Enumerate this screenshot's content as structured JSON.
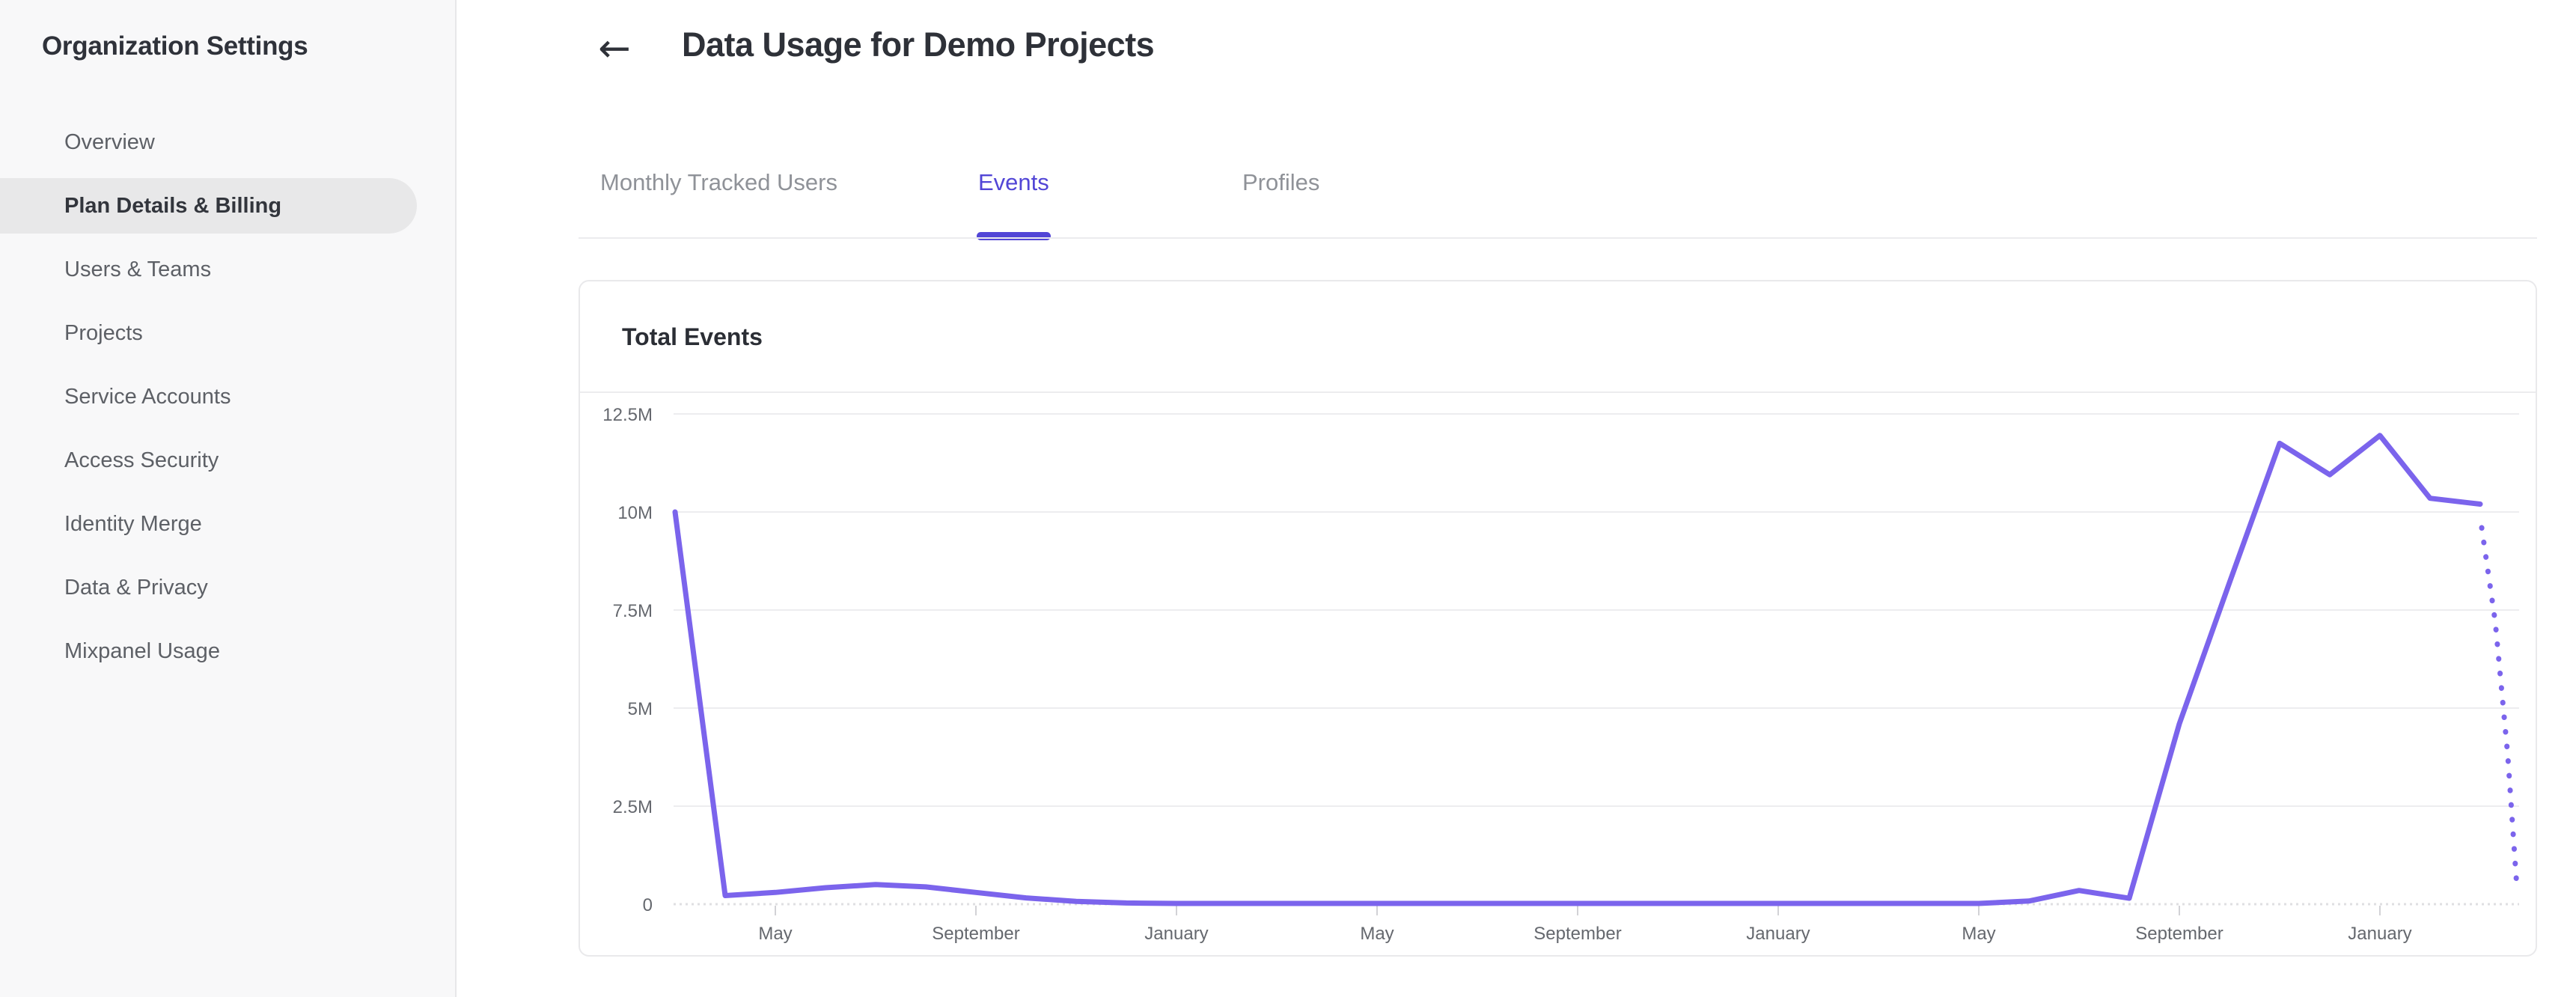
{
  "sidebar": {
    "title": "Organization Settings",
    "items": [
      {
        "label": "Overview",
        "active": false
      },
      {
        "label": "Plan Details & Billing",
        "active": true
      },
      {
        "label": "Users & Teams",
        "active": false
      },
      {
        "label": "Projects",
        "active": false
      },
      {
        "label": "Service Accounts",
        "active": false
      },
      {
        "label": "Access Security",
        "active": false
      },
      {
        "label": "Identity Merge",
        "active": false
      },
      {
        "label": "Data & Privacy",
        "active": false
      },
      {
        "label": "Mixpanel Usage",
        "active": false
      }
    ]
  },
  "header": {
    "back_icon": "←",
    "title": "Data Usage for Demo Projects"
  },
  "tabs": [
    {
      "label": "Monthly Tracked Users",
      "active": false
    },
    {
      "label": "Events",
      "active": true
    },
    {
      "label": "Profiles",
      "active": false
    }
  ],
  "colors": {
    "accent": "#5246d6",
    "line": "#7b64ec",
    "grid": "#ededef"
  },
  "chart_data": {
    "type": "line",
    "title": "Total Events",
    "ylabel": "",
    "xlabel": "",
    "ylim_millions": [
      0,
      12.5
    ],
    "grid": true,
    "legend": false,
    "y_tick_labels": [
      "12.5M",
      "10M",
      "7.5M",
      "5M",
      "2.5M",
      "0"
    ],
    "y_tick_values_millions": [
      12.5,
      10,
      7.5,
      5,
      2.5,
      0
    ],
    "x_tick_labels": [
      "May",
      "September",
      "January",
      "May",
      "September",
      "January",
      "May",
      "September",
      "January"
    ],
    "x_tick_month_indices": [
      2,
      6,
      10,
      14,
      18,
      22,
      26,
      30,
      34
    ],
    "series": [
      {
        "name": "total-events",
        "style": "solid",
        "points_month_index_vs_millions": [
          [
            0,
            10.0
          ],
          [
            1,
            0.22
          ],
          [
            2,
            0.3
          ],
          [
            3,
            0.42
          ],
          [
            4,
            0.5
          ],
          [
            5,
            0.44
          ],
          [
            6,
            0.3
          ],
          [
            7,
            0.16
          ],
          [
            8,
            0.07
          ],
          [
            9,
            0.03
          ],
          [
            10,
            0.02
          ],
          [
            11,
            0.02
          ],
          [
            12,
            0.02
          ],
          [
            13,
            0.02
          ],
          [
            14,
            0.02
          ],
          [
            15,
            0.02
          ],
          [
            16,
            0.02
          ],
          [
            17,
            0.02
          ],
          [
            18,
            0.02
          ],
          [
            19,
            0.02
          ],
          [
            20,
            0.02
          ],
          [
            21,
            0.02
          ],
          [
            22,
            0.02
          ],
          [
            23,
            0.02
          ],
          [
            24,
            0.02
          ],
          [
            25,
            0.02
          ],
          [
            26,
            0.02
          ],
          [
            27,
            0.08
          ],
          [
            28,
            0.35
          ],
          [
            29,
            0.15
          ],
          [
            30,
            4.6
          ],
          [
            31,
            8.2
          ],
          [
            32,
            11.75
          ],
          [
            33,
            10.95
          ],
          [
            34,
            11.95
          ],
          [
            35,
            10.35
          ],
          [
            36,
            10.2
          ]
        ]
      },
      {
        "name": "projection",
        "style": "dotted",
        "points_month_index_vs_millions": [
          [
            36.03,
            9.6
          ],
          [
            36.3,
            7.2
          ],
          [
            36.55,
            3.8
          ],
          [
            36.73,
            0.45
          ]
        ]
      }
    ]
  }
}
